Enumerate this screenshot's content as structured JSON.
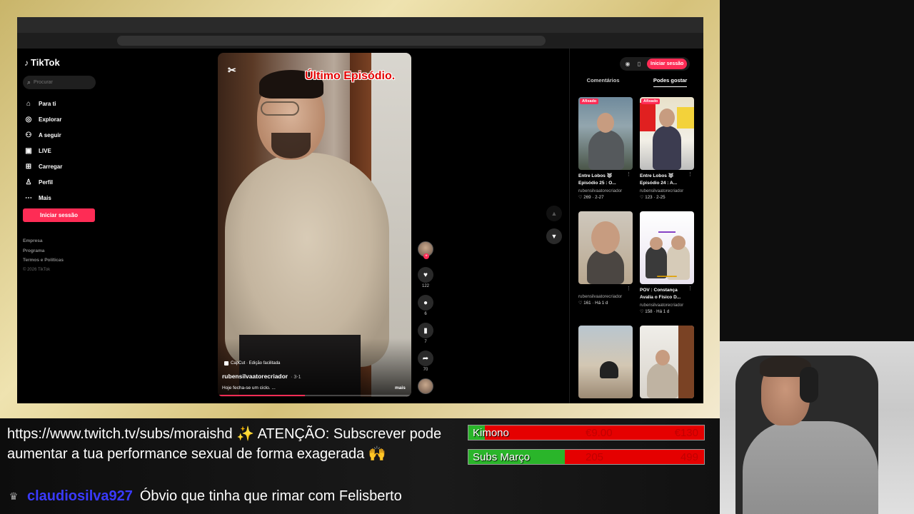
{
  "tiktok": {
    "logo": "TikTok",
    "search_placeholder": "Procurar",
    "nav": [
      {
        "label": "Para ti",
        "icon": "home-icon"
      },
      {
        "label": "Explorar",
        "icon": "compass-icon"
      },
      {
        "label": "A seguir",
        "icon": "following-icon"
      },
      {
        "label": "LIVE",
        "icon": "live-icon"
      },
      {
        "label": "Carregar",
        "icon": "upload-icon"
      },
      {
        "label": "Perfil",
        "icon": "profile-icon"
      },
      {
        "label": "Mais",
        "icon": "more-icon"
      }
    ],
    "login_label": "Iniciar sessão",
    "footer": [
      "Empresa",
      "Programa",
      "Termos e Políticas"
    ],
    "copyright": "© 2026 TikTok"
  },
  "video": {
    "overlay_title": "Último Episódio.",
    "capcut_tag": "CapCut · Edição facilitada",
    "username": "rubensilvaatorecriador",
    "date": "· 3-1",
    "description": "Hoje fecha-se um ciclo. ...",
    "more_label": "mais",
    "likes": "122",
    "comments": "6",
    "saves": "7",
    "shares": "70",
    "progress": 0.45
  },
  "right_panel": {
    "login_label": "Iniciar sessão",
    "tabs": [
      "Comentários",
      "Podes gostar"
    ],
    "active_tab": 1,
    "cards": [
      {
        "pinned": "Afixado",
        "title": "Entre Lobos 🐺 Episódio 25 : O...",
        "user": "rubensilvaatorecriador",
        "likes": "269",
        "date": "2-27"
      },
      {
        "pinned": "Afixado",
        "title": "Entre Lobos 🐺 Episódio 24 : A...",
        "user": "rubensilvaatorecriador",
        "likes": "123",
        "date": "2-25"
      },
      {
        "pinned": "",
        "title": "",
        "user": "rubensilvaatorecriador",
        "likes": "161",
        "date": "Há 1 d"
      },
      {
        "pinned": "",
        "title": "POV : Constança Avalia o Físico D...",
        "user": "rubensilvaatorecriador",
        "likes": "158",
        "date": "Há 1 d"
      },
      {
        "pinned": "",
        "title": "",
        "user": "",
        "likes": "",
        "date": ""
      },
      {
        "pinned": "",
        "title": "",
        "user": "",
        "likes": "",
        "date": ""
      }
    ]
  },
  "stream": {
    "alert": "https://www.twitch.tv/subs/moraishd ✨ ATENÇÃO: Subscrever pode aumentar a tua performance sexual de forma exagerada 🙌",
    "chat_user": "claudiosilva927",
    "chat_message": "Óbvio que tinha que rimar com Felisberto",
    "goals": [
      {
        "label": "Kimono",
        "current": "€9.00",
        "target": "€130",
        "fraction": 0.07
      },
      {
        "label": "Subs Março",
        "current": "205",
        "target": "499",
        "fraction": 0.41
      }
    ]
  },
  "colors": {
    "tiktok_red": "#fe2c55",
    "goal_red": "#e50000",
    "goal_green": "#2ab52a",
    "chat_user": "#3a3aff"
  }
}
